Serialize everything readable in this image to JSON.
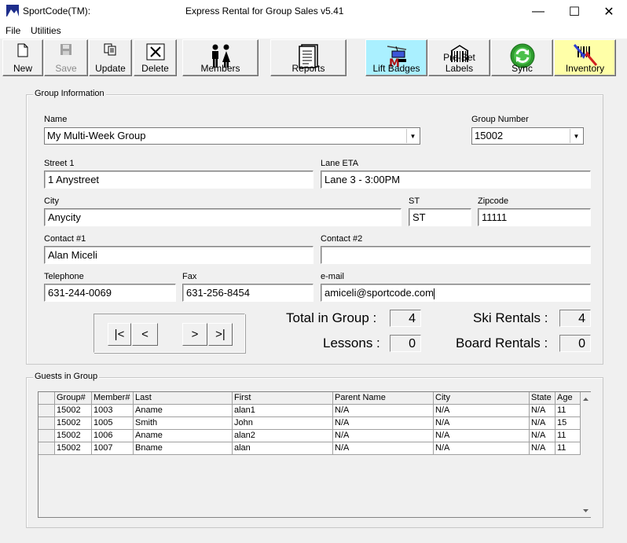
{
  "window": {
    "app_name": "SportCode(TM):",
    "title": "Express Rental for Group Sales  v5.41",
    "controls": [
      "—",
      "☐",
      "✕"
    ]
  },
  "menu": {
    "items": [
      "File",
      "Utilities"
    ]
  },
  "toolbar": {
    "buttons": [
      {
        "label": "New",
        "icon": "new-document-icon"
      },
      {
        "label": "Save",
        "icon": "floppy-disk-icon"
      },
      {
        "label": "Update",
        "icon": "update-pages-icon"
      },
      {
        "label": "Delete",
        "icon": "delete-x-icon"
      },
      {
        "label": "Members",
        "icon": "people-icon"
      },
      {
        "label": "Reports",
        "icon": "report-icon"
      },
      {
        "label": "Lift Badges",
        "icon": "lift-badge-icon"
      },
      {
        "label": "Pre-Set Labels",
        "icon": "barcode-icon"
      },
      {
        "label": "Sync",
        "icon": "sync-icon"
      },
      {
        "label": "Inventory",
        "icon": "inventory-icon"
      }
    ]
  },
  "group_info": {
    "title": "Group Information",
    "name": {
      "label": "Name",
      "value": "My Multi-Week Group"
    },
    "group_number": {
      "label": "Group Number",
      "value": "15002"
    },
    "street1": {
      "label": "Street 1",
      "value": "1 Anystreet"
    },
    "lane_eta": {
      "label": "Lane ETA",
      "value": "Lane 3 - 3:00PM"
    },
    "city": {
      "label": "City",
      "value": "Anycity"
    },
    "st": {
      "label": "ST",
      "value": "ST"
    },
    "zipcode": {
      "label": "Zipcode",
      "value": "11111"
    },
    "contact1": {
      "label": "Contact #1",
      "value": "Alan Miceli"
    },
    "contact2": {
      "label": "Contact #2",
      "value": ""
    },
    "telephone": {
      "label": "Telephone",
      "value": "631-244-0069"
    },
    "fax": {
      "label": "Fax",
      "value": "631-256-8454"
    },
    "email": {
      "label": "e-mail",
      "value": "amiceli@sportcode.com"
    },
    "nav": {
      "first": "|<",
      "prev": "<",
      "next": ">",
      "last": ">|"
    },
    "stats": {
      "total_in_group": {
        "label": "Total in Group :",
        "value": "4"
      },
      "lessons": {
        "label": "Lessons :",
        "value": "0"
      },
      "ski_rentals": {
        "label": "Ski Rentals :",
        "value": "4"
      },
      "board_rentals": {
        "label": "Board Rentals :",
        "value": "0"
      }
    }
  },
  "guests": {
    "title": "Guests in Group",
    "columns": [
      "Group#",
      "Member#",
      "Last",
      "First",
      "Parent Name",
      "City",
      "State",
      "Age"
    ],
    "rows": [
      [
        "15002",
        "1003",
        "Aname",
        "alan1",
        "N/A",
        "N/A",
        "N/A",
        "11"
      ],
      [
        "15002",
        "1005",
        "Smith",
        "John",
        "N/A",
        "N/A",
        "N/A",
        "15"
      ],
      [
        "15002",
        "1006",
        "Aname",
        "alan2",
        "N/A",
        "N/A",
        "N/A",
        "11"
      ],
      [
        "15002",
        "1007",
        "Bname",
        "alan",
        "N/A",
        "N/A",
        "N/A",
        "11"
      ]
    ]
  }
}
